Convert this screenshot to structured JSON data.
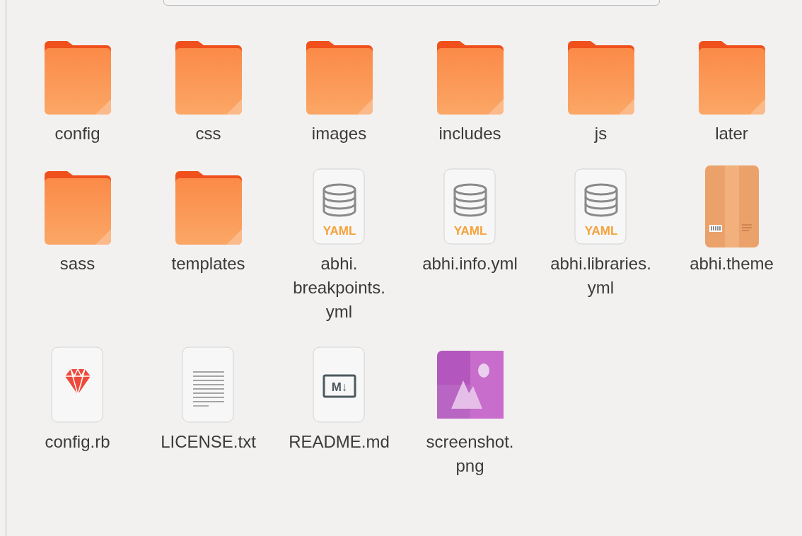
{
  "files": [
    {
      "name": "config",
      "kind": "folder"
    },
    {
      "name": "css",
      "kind": "folder"
    },
    {
      "name": "images",
      "kind": "folder"
    },
    {
      "name": "includes",
      "kind": "folder"
    },
    {
      "name": "js",
      "kind": "folder"
    },
    {
      "name": "later",
      "kind": "folder"
    },
    {
      "name": "sass",
      "kind": "folder"
    },
    {
      "name": "templates",
      "kind": "folder"
    },
    {
      "name": "abhi.breakpoints.yml",
      "kind": "yaml",
      "badge": "YAML"
    },
    {
      "name": "abhi.info.yml",
      "kind": "yaml",
      "badge": "YAML"
    },
    {
      "name": "abhi.libraries.yml",
      "kind": "yaml",
      "badge": "YAML"
    },
    {
      "name": "abhi.theme",
      "kind": "package"
    },
    {
      "name": "config.rb",
      "kind": "ruby"
    },
    {
      "name": "LICENSE.txt",
      "kind": "text"
    },
    {
      "name": "README.md",
      "kind": "markdown",
      "badge": "M↓"
    },
    {
      "name": "screenshot.png",
      "kind": "image"
    }
  ]
}
